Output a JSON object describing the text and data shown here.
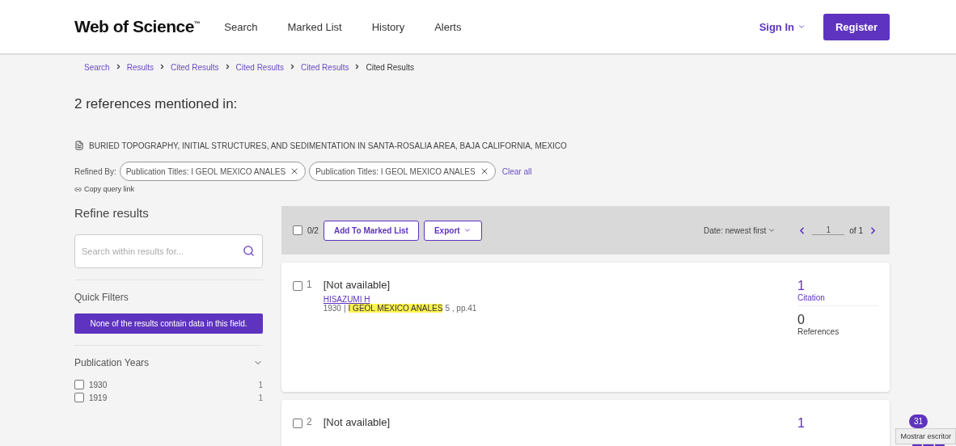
{
  "header": {
    "logo": "Web of Science",
    "logo_mark": "™",
    "nav": [
      {
        "label": "Search"
      },
      {
        "label": "Marked List"
      },
      {
        "label": "History"
      },
      {
        "label": "Alerts"
      }
    ],
    "sign_in": "Sign In",
    "register": "Register"
  },
  "breadcrumbs": [
    {
      "label": "Search",
      "link": true
    },
    {
      "label": "Results",
      "link": true
    },
    {
      "label": "Cited Results",
      "link": true
    },
    {
      "label": "Cited Results",
      "link": true
    },
    {
      "label": "Cited Results",
      "link": true
    },
    {
      "label": "Cited Results",
      "link": false
    }
  ],
  "heading": {
    "count": "2",
    "text": "references mentioned in:"
  },
  "source_document": "BURIED TOPOGRAPHY, INITIAL STRUCTURES, AND SEDIMENTATION IN SANTA-ROSALIA AREA, BAJA CALIFORNIA, MEXICO",
  "refined_by": {
    "label": "Refined By:",
    "chips": [
      {
        "label": "Publication Titles: I GEOL MEXICO ANALES"
      },
      {
        "label": "Publication Titles: I GEOL MEXICO ANALES"
      }
    ],
    "clear": "Clear all"
  },
  "copy_link": "Copy query link",
  "sidebar": {
    "title": "Refine results",
    "search": {
      "placeholder": "Search within results for..."
    },
    "quick_filters": {
      "title": "Quick Filters",
      "notice": "None of the results contain data in this field."
    },
    "publication_years": {
      "title": "Publication Years",
      "expanded": true,
      "items": [
        {
          "label": "1930",
          "count": "1",
          "checked": false
        },
        {
          "label": "1919",
          "count": "1",
          "checked": false
        }
      ]
    }
  },
  "toolbar": {
    "select_all": {
      "checked": false,
      "label": "0/2"
    },
    "add_button": "Add To Marked List",
    "export_button": "Export",
    "sort": "Date: newest first",
    "page": "1",
    "of": "of 1"
  },
  "records": [
    {
      "number": "1",
      "checked": false,
      "title": "[Not available]",
      "author": "HISAZUMI H",
      "year": "1930",
      "separator": "|",
      "source": "I GEOL MEXICO ANALES",
      "details": "5 , pp.41",
      "citations": "1",
      "citations_label": "Citation",
      "references": "0",
      "references_label": "References"
    },
    {
      "number": "2",
      "checked": false,
      "title": "[Not available]",
      "citations": "1"
    }
  ],
  "chat_badge": "31",
  "tooltip": "Mostrar escritor"
}
